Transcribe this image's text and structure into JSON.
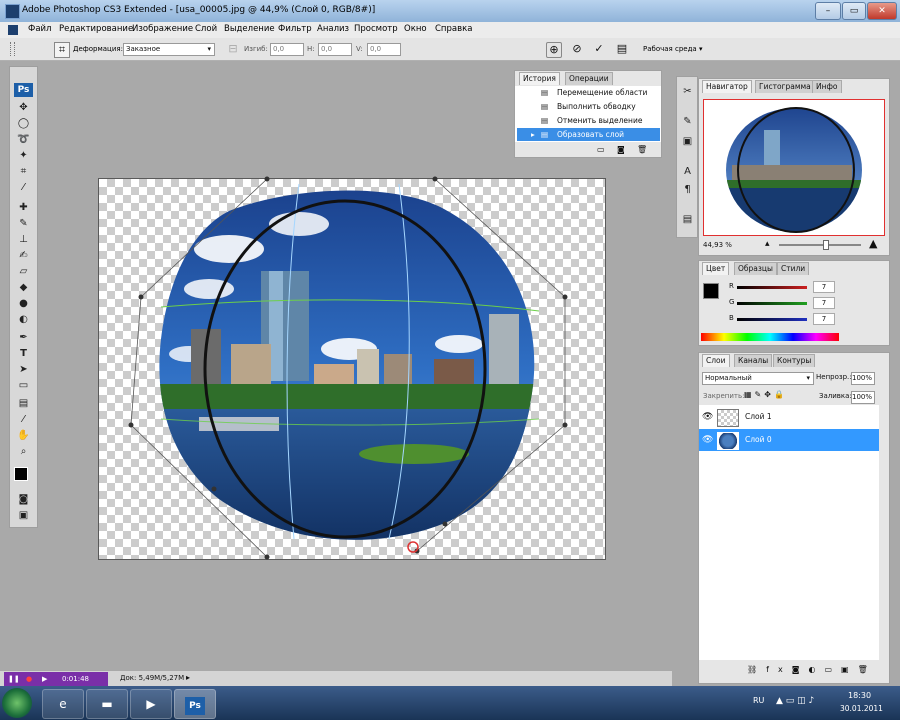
{
  "window": {
    "title": "Adobe Photoshop CS3 Extended - [usa_00005.jpg @ 44,9% (Слой 0, RGB/8#)]",
    "controls": {
      "minimize": "–",
      "maximize": "▭",
      "close": "✕"
    }
  },
  "menu": [
    "Файл",
    "Редактирование",
    "Изображение",
    "Слой",
    "Выделение",
    "Фильтр",
    "Анализ",
    "Просмотр",
    "Окно",
    "Справка"
  ],
  "options_bar": {
    "deform_label": "Деформация:",
    "deform_value": "Заказное",
    "bend_label": "Изгиб:",
    "bend_value": "0,0",
    "h_label": "H:",
    "h_value": "0,0",
    "v_label": "V:",
    "v_value": "0,0",
    "workspace": "Рабочая среда"
  },
  "toolbox": {
    "logo": "Ps"
  },
  "history_panel": {
    "tabs": [
      "История",
      "Операции"
    ],
    "items": [
      "Перемещение области",
      "Выполнить обводку",
      "Отменить выделение",
      "Образовать слой"
    ],
    "selected_index": 3
  },
  "navigator_panel": {
    "tabs": [
      "Навигатор",
      "Гистограмма",
      "Инфо"
    ],
    "zoom": "44,93 %"
  },
  "color_panel": {
    "tabs": [
      "Цвет",
      "Образцы",
      "Стили"
    ],
    "channels": [
      {
        "label": "R",
        "value": "7",
        "color": "#cc2020"
      },
      {
        "label": "G",
        "value": "7",
        "color": "#20a020"
      },
      {
        "label": "B",
        "value": "7",
        "color": "#2030c0"
      }
    ]
  },
  "layers_panel": {
    "tabs": [
      "Слои",
      "Каналы",
      "Контуры"
    ],
    "blend_mode": "Нормальный",
    "opacity_label": "Непрозр.:",
    "opacity_value": "100%",
    "lock_label": "Закрепить:",
    "fill_label": "Заливка:",
    "fill_value": "100%",
    "layers": [
      {
        "name": "Слой 1",
        "selected": false
      },
      {
        "name": "Слой 0",
        "selected": true
      }
    ]
  },
  "status_bar": {
    "timer": "0:01:48",
    "doc": "Док: 5,49M/5,27M"
  },
  "taskbar": {
    "lang": "RU",
    "time": "18:30",
    "date": "30.01.2011",
    "ps_label": "Ps"
  },
  "colors": {
    "accent": "#3399ff",
    "selection": "#3a8ee6",
    "recorder": "#7a2fa8"
  }
}
